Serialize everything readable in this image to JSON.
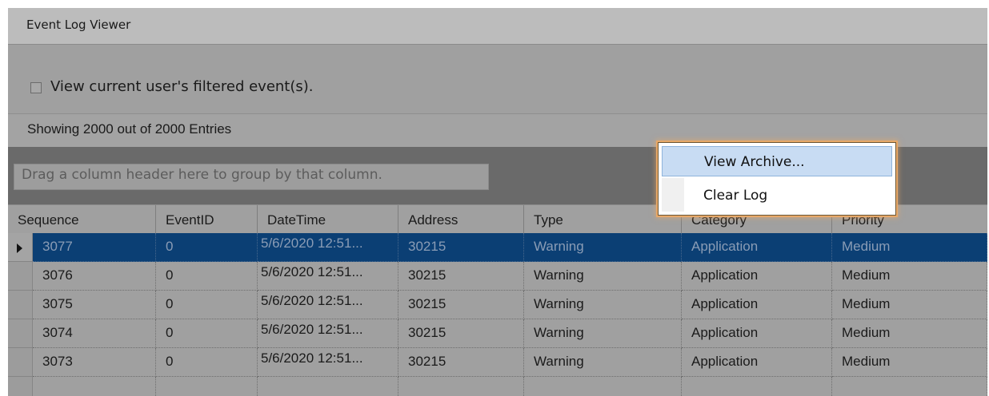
{
  "window": {
    "title": "Event Log Viewer"
  },
  "filter": {
    "checkbox_label": "View current user's filtered event(s).",
    "checked": false
  },
  "status": {
    "text": "Showing 2000 out of 2000 Entries"
  },
  "group_panel": {
    "placeholder": "Drag a column header here to group by that column."
  },
  "grid": {
    "columns": [
      "Sequence",
      "EventID",
      "DateTime",
      "Address",
      "Type",
      "Category",
      "Priority"
    ],
    "rows": [
      {
        "sequence": "3077",
        "event_id": "0",
        "datetime": "5/6/2020 12:51...",
        "address": "30215",
        "type": "Warning",
        "category": "Application",
        "priority": "Medium",
        "selected": true
      },
      {
        "sequence": "3076",
        "event_id": "0",
        "datetime": "5/6/2020 12:51...",
        "address": "30215",
        "type": "Warning",
        "category": "Application",
        "priority": "Medium"
      },
      {
        "sequence": "3075",
        "event_id": "0",
        "datetime": "5/6/2020 12:51...",
        "address": "30215",
        "type": "Warning",
        "category": "Application",
        "priority": "Medium"
      },
      {
        "sequence": "3074",
        "event_id": "0",
        "datetime": "5/6/2020 12:51...",
        "address": "30215",
        "type": "Warning",
        "category": "Application",
        "priority": "Medium"
      },
      {
        "sequence": "3073",
        "event_id": "0",
        "datetime": "5/6/2020 12:51...",
        "address": "30215",
        "type": "Warning",
        "category": "Application",
        "priority": "Medium"
      }
    ]
  },
  "context_menu": {
    "items": [
      {
        "label": "View Archive...",
        "highlighted": true
      },
      {
        "label": "Clear Log",
        "highlighted": false
      }
    ]
  },
  "colors": {
    "selected_row": "#0b3f74",
    "menu_highlight": "#c8dcf3",
    "menu_glow": "#e7a868",
    "background": "#a0a0a0"
  }
}
